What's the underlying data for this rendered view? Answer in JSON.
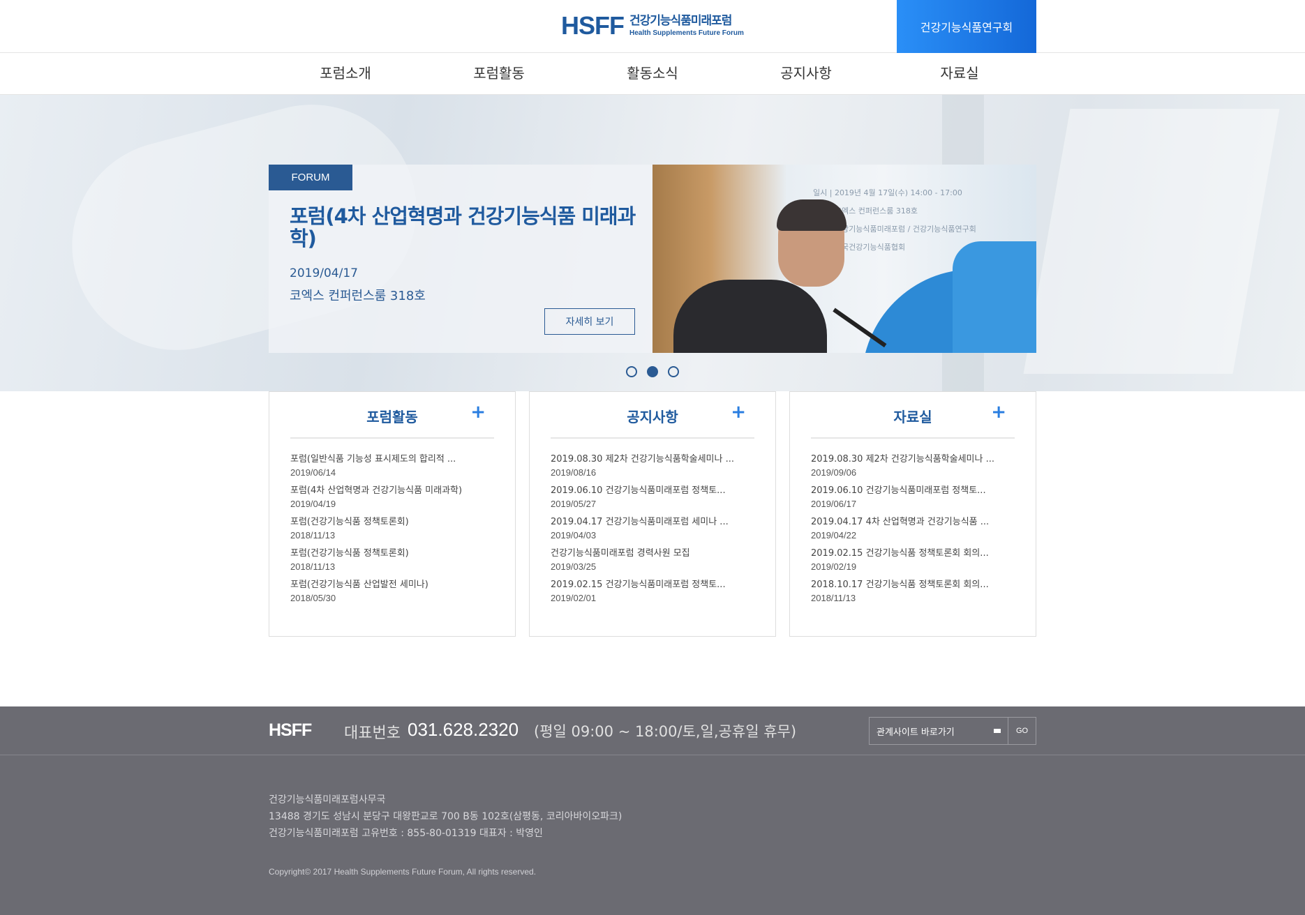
{
  "header": {
    "logo_mark": "HSFF",
    "logo_ko": "건강기능식품미래포럼",
    "logo_en": "Health Supplements Future Forum",
    "research_label": "건강기능식품연구회",
    "accent": "#1f5a9e",
    "button_color": "#1e7ae8"
  },
  "nav": {
    "items": [
      "포럼소개",
      "포럼활동",
      "활동소식",
      "공지사항",
      "자료실"
    ]
  },
  "hero": {
    "tag": "FORUM",
    "title": "포럼(4차 산업혁명과 건강기능식품 미래과학)",
    "date": "2019/04/17",
    "place": "코엑스 컨퍼런스룸 318호",
    "detail_label": "자세히 보기",
    "photo_lines": [
      "일시 | 2019년 4월 17일(수) 14:00 - 17:00",
      "장소 | 코엑스 컨퍼런스룸 318호",
      "주최 | 건강기능식품미래포럼 / 건강기능식품연구회",
      "후원 | 한국건강기능식품협회"
    ],
    "slides_total": 3,
    "slide_active": 2
  },
  "boards": [
    {
      "title": "포럼활동",
      "plus": "+",
      "items": [
        {
          "title": "포럼(일반식품 기능성 표시제도의 합리적 ...",
          "date": "2019/06/14"
        },
        {
          "title": "포럼(4차 산업혁명과 건강기능식품 미래과학)",
          "date": "2019/04/19"
        },
        {
          "title": "포럼(건강기능식품 정책토론회)",
          "date": "2018/11/13"
        },
        {
          "title": "포럼(건강기능식품 정책토론회)",
          "date": "2018/11/13"
        },
        {
          "title": "포럼(건강기능식품 산업발전 세미나)",
          "date": "2018/05/30"
        }
      ]
    },
    {
      "title": "공지사항",
      "plus": "+",
      "items": [
        {
          "title": "2019.08.30 제2차 건강기능식품학술세미나 ...",
          "date": "2019/08/16"
        },
        {
          "title": "2019.06.10 건강기능식품미래포럼 정책토...",
          "date": "2019/05/27"
        },
        {
          "title": "2019.04.17 건강기능식품미래포럼 세미나 ...",
          "date": "2019/04/03"
        },
        {
          "title": "건강기능식품미래포럼 경력사원 모집",
          "date": "2019/03/25"
        },
        {
          "title": "2019.02.15 건강기능식품미래포럼 정책토...",
          "date": "2019/02/01"
        }
      ]
    },
    {
      "title": "자료실",
      "plus": "+",
      "items": [
        {
          "title": "2019.08.30 제2차 건강기능식품학술세미나 ...",
          "date": "2019/09/06"
        },
        {
          "title": "2019.06.10 건강기능식품미래포럼 정책토...",
          "date": "2019/06/17"
        },
        {
          "title": "2019.04.17 4차 산업혁명과 건강기능식품 ...",
          "date": "2019/04/22"
        },
        {
          "title": "2019.02.15 건강기능식품 정책토론회 회의...",
          "date": "2019/02/19"
        },
        {
          "title": "2018.10.17 건강기능식품 정책토론회 회의...",
          "date": "2018/11/13"
        }
      ]
    }
  ],
  "footer": {
    "logo": "HSFF",
    "phone_label": "대표번호",
    "phone": "031.628.2320",
    "hours": "(평일 09:00 ~ 18:00/토,일,공휴일 휴무)",
    "related_label": "관계사이트 바로가기",
    "go_label": "GO",
    "office": "건강기능식품미래포럼사무국",
    "address": "13488 경기도 성남시 분당구 대왕판교로 700 B동 102호(삼평동, 코리아바이오파크)",
    "registration": "건강기능식품미래포럼 고유번호 : 855-80-01319 대표자 : 박영인",
    "copyright": "Copyright© 2017 Health Supplements Future Forum, All rights reserved.",
    "bg_color": "#6b6b72"
  }
}
